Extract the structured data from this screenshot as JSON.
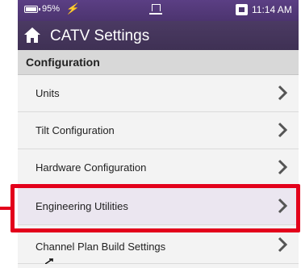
{
  "statusbar": {
    "battery_percent": "95%",
    "charging_glyph": "⚡",
    "time": "11:14 AM",
    "icons": [
      "battery-icon",
      "charging-bolt-icon",
      "usb-icon",
      "lan-icon"
    ]
  },
  "titlebar": {
    "title": "CATV Settings",
    "icon": "home-icon"
  },
  "section": {
    "header": "Configuration"
  },
  "menu": {
    "items": [
      {
        "label": "Units"
      },
      {
        "label": "Tilt Configuration"
      },
      {
        "label": "Hardware Configuration"
      },
      {
        "label": "Engineering Utilities",
        "highlighted": true
      },
      {
        "label": "Channel Plan Build Settings"
      }
    ]
  },
  "colors": {
    "statusbar": "#4c346f",
    "titlebar": "#3f3154",
    "highlight": "#e3001b",
    "background": "#f3f3f3"
  }
}
